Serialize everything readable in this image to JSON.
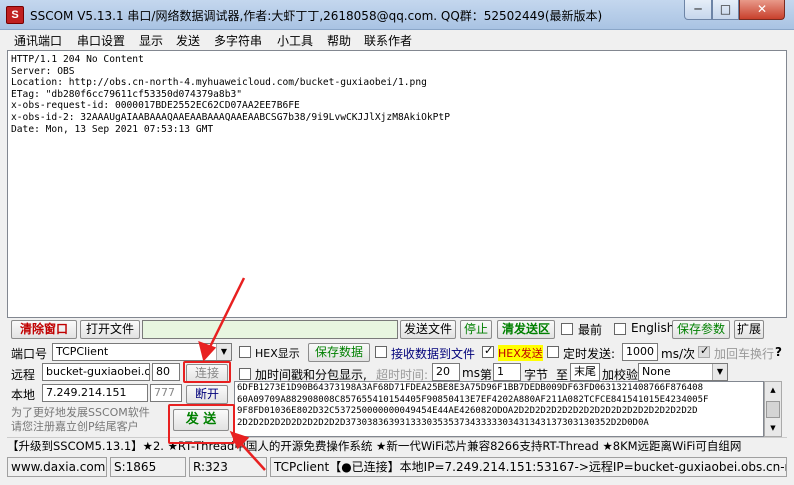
{
  "window": {
    "icon_letter": "S",
    "title": "SSCOM V5.13.1 串口/网络数据调试器,作者:大虾丁丁,2618058@qq.com. QQ群：52502449(最新版本)",
    "min_symbol": "─",
    "max_symbol": "□",
    "close_symbol": "✕"
  },
  "menu": [
    "通讯端口",
    "串口设置",
    "显示",
    "发送",
    "多字符串",
    "小工具",
    "帮助",
    "联系作者"
  ],
  "receive_text": "HTTP/1.1 204 No Content\nServer: OBS\nLocation: http://obs.cn-north-4.myhuaweicloud.com/bucket-guxiaobei/1.png\nETag: \"db280f6cc79611cf53350d074379a8b3\"\nx-obs-request-id: 0000017BDE2552EC62CD07AA2EE7B6FE\nx-obs-id-2: 32AAAUgAIAABAAAQAAEAABAAAQAAEAABCSG7b38/9i9LvwCKJJlXjzM8AkiOkPtP\nDate: Mon, 13 Sep 2021 07:53:13 GMT",
  "toolbar1": {
    "clear_window": "清除窗口",
    "open_file": "打开文件",
    "send_file": "发送文件",
    "stop": "停止",
    "clear_send": "清发送区",
    "topmost": "最前",
    "english": "English",
    "save_params": "保存参数",
    "expand": "扩展"
  },
  "port": {
    "label": "端口号",
    "value": "TCPClient",
    "hex_display": "HEX显示",
    "save_data": "保存数据",
    "recv_to_file": "接收数据到文件",
    "hex_send": "HEX发送",
    "timed_send": "定时发送:",
    "interval": "1000",
    "interval_unit": "ms/次",
    "add_crlf": "加回车换行"
  },
  "remote": {
    "label": "远程",
    "address": "bucket-guxiaobei.obs.",
    "port": "80",
    "connect": "连接",
    "timestamp": "加时间戳和分包显示,",
    "timeout_label": "超时时间:",
    "timeout": "20",
    "timeout_unit": "ms",
    "nth_label": "第",
    "nth_value": "1",
    "byte_label": "字节",
    "to_label": "至",
    "end_value": "末尾",
    "checksum_label": "加校验",
    "checksum_value": "None"
  },
  "local": {
    "label": "本地",
    "address": "7.249.214.151",
    "port": "777",
    "disconnect": "断开"
  },
  "promo": "为了更好地发展SSCOM软件\n请您注册嘉立创P结尾客户",
  "send_button": "发  送",
  "hex_data": "6DFB1273E1D90B64373198A3AF68D71FDEA25BE8E3A75D96F1BB7DEDB009DF63FD0631321408766F876408\n60A09709A882908008C857655410154405F90850413E7EF4202A880AF211A082TCFCE841541015E4234005F\n9F8FD01036E802D32C537250000000049454E44AE426082ODOA2D2D2D2D2D2D2D2D2D2D2D2D2D2D2D2D2D\n2D2D2D2D2D2D2D2D2D2D3730383639313330353537343333303431343137303130352D2D0D0A",
  "ad": "【升级到SSCOM5.13.1】★2. ★RT-Thread中国人的开源免费操作系统 ★新一代WiFi芯片兼容8266支持RT-Thread ★8KM远距离WiFi可自组网",
  "status": {
    "site": "www.daxia.com",
    "sent": "S:1865",
    "received": "R:323",
    "connection": "TCPclient【●已连接】本地IP=7.249.214.151:53167->远程IP=bucket-guxiaobei.obs.cn-no"
  },
  "colors": {
    "annotation_red": "#e82020",
    "green_text": "#008000",
    "red_text": "#c00000"
  }
}
